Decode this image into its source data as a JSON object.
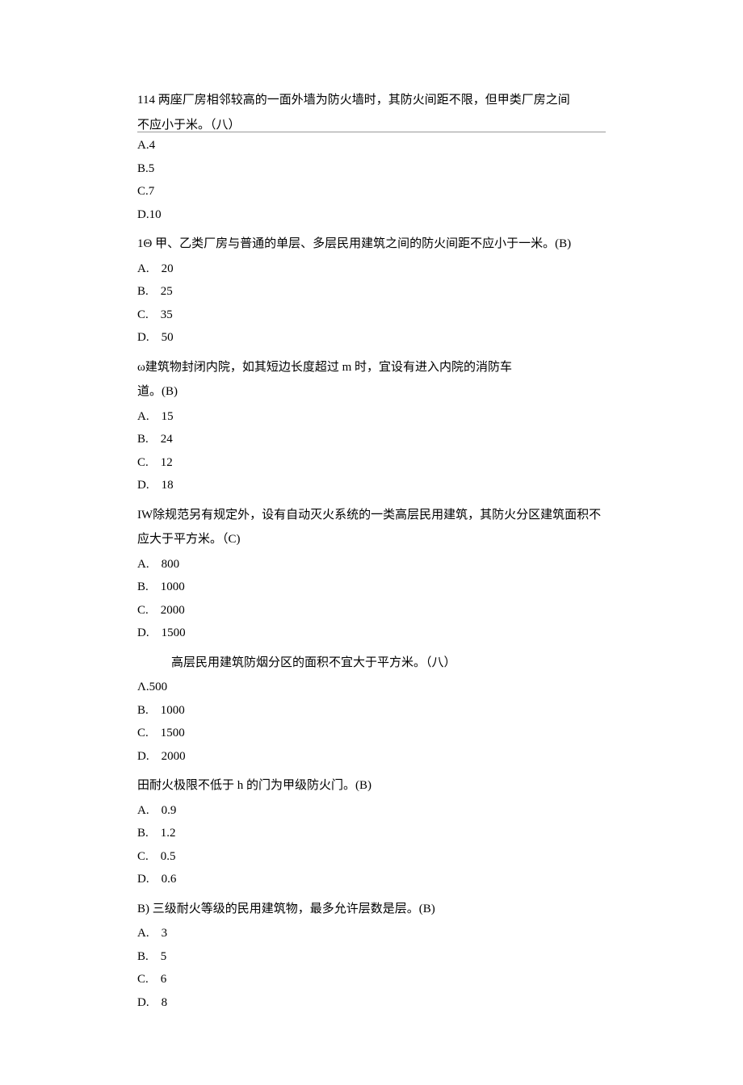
{
  "questions": [
    {
      "prefix": "114",
      "text_lines": [
        "两座厂房相邻较高的一面外墙为防火墙时，其防火间距不限，但甲类厂房之间",
        "不应小于米。（八）"
      ],
      "hr_after": true,
      "options": [
        {
          "label": "A.4",
          "indent": false
        },
        {
          "label": "B.5",
          "indent": false
        },
        {
          "label": "C.7",
          "indent": false
        },
        {
          "label": "D.10",
          "indent": false
        }
      ]
    },
    {
      "prefix": "1Θ",
      "text_lines": [
        "甲、乙类厂房与普通的单层、多层民用建筑之间的防火间距不应小于一米。(B)"
      ],
      "options": [
        {
          "label": "A.",
          "value": "20",
          "indent": true
        },
        {
          "label": "B.",
          "value": "25",
          "indent": true
        },
        {
          "label": "C.",
          "value": "35",
          "indent": true
        },
        {
          "label": "D.",
          "value": "50",
          "indent": true
        }
      ]
    },
    {
      "prefix": "ω",
      "text_lines": [
        "建筑物封闭内院，如其短边长度超过 m 时，宜设有进入内院的消防车",
        "道。(B)"
      ],
      "prefix_join": "",
      "options": [
        {
          "label": "A.",
          "value": "15",
          "indent": true
        },
        {
          "label": "B.",
          "value": "24",
          "indent": true
        },
        {
          "label": "C.",
          "value": "12",
          "indent": true
        },
        {
          "label": "D.",
          "value": "18",
          "indent": true
        }
      ]
    },
    {
      "prefix": "IW",
      "text_lines": [
        "除规范另有规定外，设有自动灭火系统的一类高层民用建筑，其防火分区建筑面积不",
        "应大于平方米。（C)"
      ],
      "prefix_join": "",
      "options": [
        {
          "label": "A.",
          "value": "800",
          "indent": true
        },
        {
          "label": "B.",
          "value": "1000",
          "indent": true
        },
        {
          "label": "C.",
          "value": "2000",
          "indent": true
        },
        {
          "label": "D.",
          "value": "1500",
          "indent": true
        }
      ]
    },
    {
      "prefix": "",
      "leading_indent": true,
      "text_lines": [
        "高层民用建筑防烟分区的面积不宜大于平方米。（八）"
      ],
      "options": [
        {
          "label": "Λ.500",
          "indent": false
        },
        {
          "label": "B.",
          "value": "1000",
          "indent": true
        },
        {
          "label": "C.",
          "value": "1500",
          "indent": true
        },
        {
          "label": "D.",
          "value": "2000",
          "indent": true
        }
      ]
    },
    {
      "prefix": "田",
      "prefix_join": "",
      "text_lines": [
        "耐火极限不低于 h 的门为甲级防火门。(B)"
      ],
      "options": [
        {
          "label": "A.",
          "value": "0.9",
          "indent": true
        },
        {
          "label": "B.",
          "value": "1.2",
          "indent": true
        },
        {
          "label": "C.",
          "value": "0.5",
          "indent": true
        },
        {
          "label": "D.",
          "value": "0.6",
          "indent": true
        }
      ]
    },
    {
      "prefix": "B)",
      "prefix_join": "  ",
      "text_lines": [
        "三级耐火等级的民用建筑物，最多允许层数是层。(B)"
      ],
      "options": [
        {
          "label": "A.",
          "value": "3",
          "indent": true
        },
        {
          "label": "B.",
          "value": "5",
          "indent": true
        },
        {
          "label": "C.",
          "value": "6",
          "indent": true
        },
        {
          "label": "D.",
          "value": "8",
          "indent": true
        }
      ]
    }
  ]
}
